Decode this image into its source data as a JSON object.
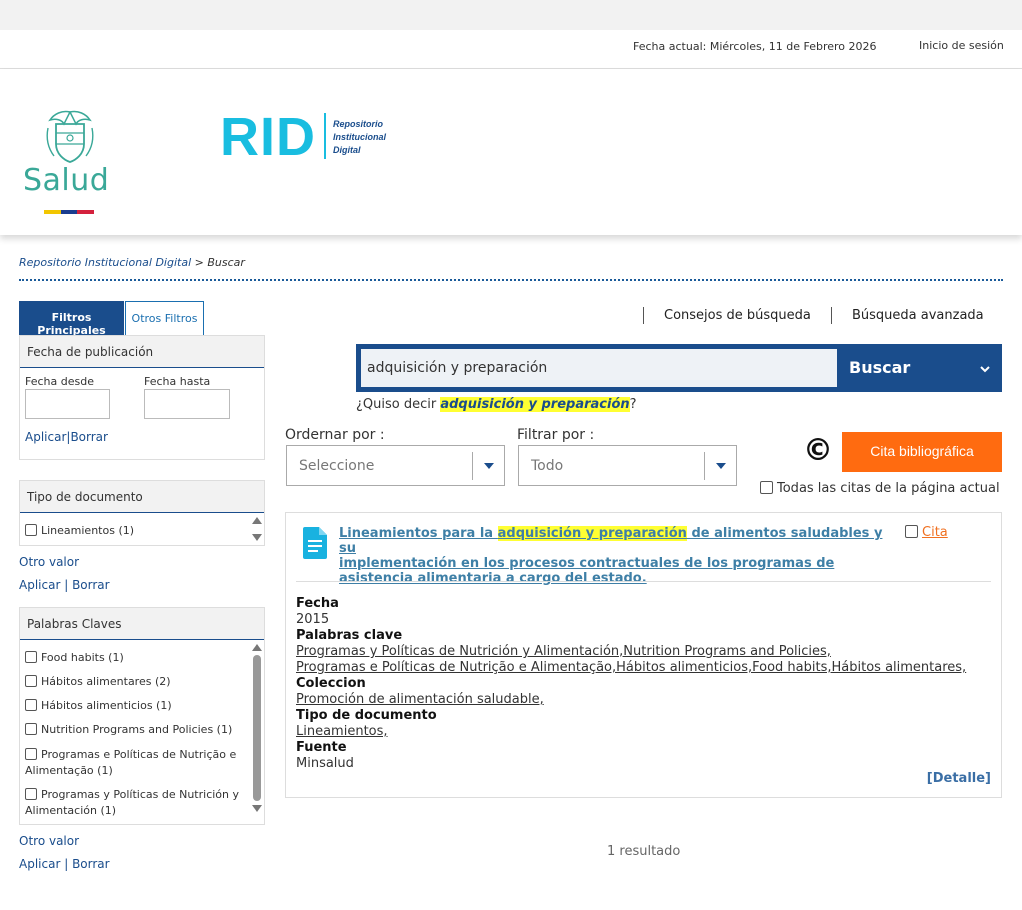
{
  "topbar": {
    "date_text": "Fecha actual: Miércoles, 11 de Febrero 2026",
    "login_label": "Inicio de sesión"
  },
  "header": {
    "salud_logo_text": "Salud",
    "rid_logo_text": "RID",
    "rid_subtitle_line1": "Repositorio",
    "rid_subtitle_line2": "Institucional",
    "rid_subtitle_line3": "Digital",
    "flag_colors": [
      "#f2c600",
      "#1a3d8f",
      "#d4213d"
    ]
  },
  "breadcrumb": {
    "home": "Repositorio Institucional Digital",
    "separator": " > ",
    "current": "Buscar"
  },
  "sidebar": {
    "tabs": [
      "Filtros Principales",
      "Otros Filtros"
    ],
    "fecha": {
      "title": "Fecha de publicación",
      "desde_label": "Fecha desde",
      "hasta_label": "Fecha hasta",
      "apply": "Aplicar",
      "sep": "|",
      "clear": "Borrar"
    },
    "tipo": {
      "title": "Tipo de documento",
      "items": [
        "Lineamientos (1)"
      ],
      "other": "Otro valor",
      "apply": "Aplicar",
      "sep": " | ",
      "clear": "Borrar"
    },
    "palabras": {
      "title": "Palabras Claves",
      "items": [
        "Food habits (1)",
        "Hábitos alimentares (2)",
        "Hábitos alimenticios (1)",
        "Nutrition Programs and Policies (1)",
        "Programas e Políticas de Nutrição e Alimentação (1)",
        "Programas y Políticas de Nutrición y Alimentación (1)"
      ],
      "other": "Otro valor",
      "apply": "Aplicar",
      "sep": " | ",
      "clear": "Borrar"
    }
  },
  "toolbar": {
    "tips": "Consejos de búsqueda",
    "advanced": "Búsqueda avanzada"
  },
  "search": {
    "value": "adquisición y preparación",
    "button": "Buscar",
    "did_you_mean_prefix": "¿Quiso decir ",
    "did_you_mean_term": "adquisición y preparación",
    "did_you_mean_suffix": "?"
  },
  "sort": {
    "label": "Ordernar por :",
    "value": "Seleccione"
  },
  "filter": {
    "label": "Filtrar por :",
    "value": "Todo"
  },
  "citation": {
    "symbol": "©",
    "button": "Cita bibliográfica",
    "all_label": "Todas las citas de la página actual"
  },
  "result": {
    "title_prefix": "Lineamientos para la ",
    "title_highlight": "adquisición y preparación",
    "title_line1_rest": " de alimentos saludables y su",
    "title_line2": "implementación en los procesos contractuales de los programas de",
    "title_line3": "asistencia alimentaria a cargo del estado.",
    "cita_label": "Cita",
    "fecha_label": "Fecha",
    "fecha_value": "2015",
    "palabras_label": "Palabras clave",
    "palabras_line1": "Programas y Políticas de Nutrición y Alimentación,Nutrition Programs and Policies,",
    "palabras_line2": "Programas e Políticas de Nutrição e Alimentação,Hábitos alimenticios,Food habits,Hábitos alimentares,",
    "coleccion_label": "Coleccion",
    "coleccion_value": "Promoción de alimentación saludable,",
    "tipo_label": "Tipo de documento",
    "tipo_value": "Lineamientos,",
    "fuente_label": "Fuente",
    "fuente_value": "Minsalud",
    "detail_link": "[Detalle]"
  },
  "footer": {
    "count": "1 resultado"
  }
}
